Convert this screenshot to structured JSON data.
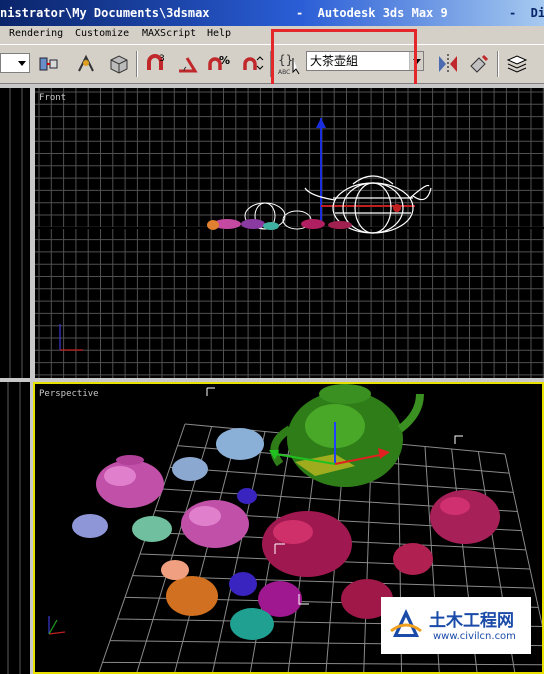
{
  "window": {
    "title_path": "nistrator\\My Documents\\3dsmax",
    "title_app": "-  Autodesk 3ds Max 9",
    "title_right": "-  Disp"
  },
  "menus": [
    {
      "label": "Rendering"
    },
    {
      "label": "Customize"
    },
    {
      "label": "MAXScript"
    },
    {
      "label": "Help"
    }
  ],
  "toolbar": {
    "named_selection_value": "大茶壶組",
    "icons": [
      "select-and-link-icon",
      "bind-to-space-warp-icon",
      "select-object-icon",
      "snap-3d-icon",
      "angle-snap-icon",
      "percent-snap-icon",
      "spinner-snap-icon",
      "edit-named-selection-icon",
      "mirror-icon",
      "align-icon",
      "layer-manager-icon"
    ],
    "snap_label": "3",
    "percent_label": "%",
    "abc_label": "ABC"
  },
  "viewports": {
    "front_label": "Front",
    "perspective_label": "Perspective"
  },
  "highlight_color": "#e4272b",
  "watermark": {
    "title": "土木工程网",
    "url": "www.civilcn.com"
  }
}
